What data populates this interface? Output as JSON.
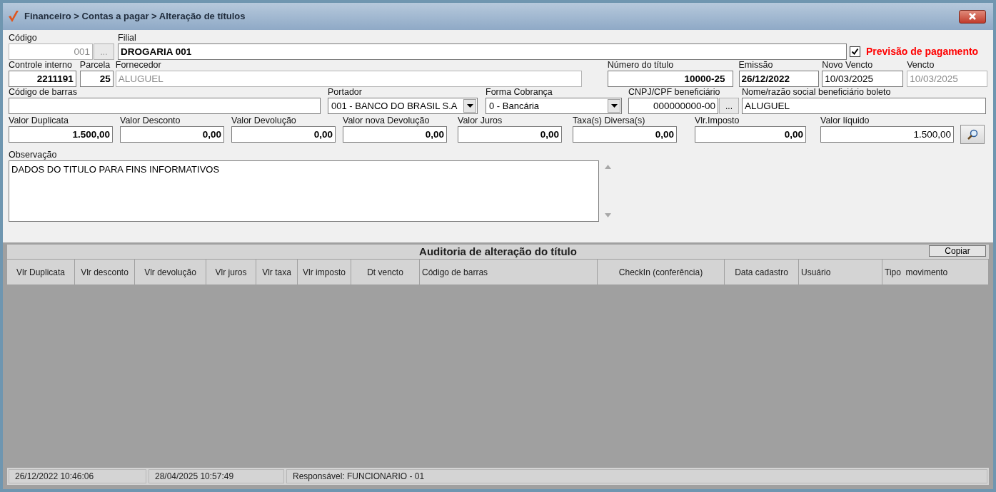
{
  "window": {
    "title": "Financeiro > Contas a pagar > Alteração de títulos"
  },
  "rows": [
    [
      {
        "kind": "text",
        "label": "Código",
        "value": "001",
        "disabled": true
      },
      {
        "kind": "ellipsis",
        "value": "...",
        "disabled": true
      },
      {
        "kind": "text",
        "label": "Filial",
        "value": "DROGARIA 001",
        "disabled": false
      },
      {
        "kind": "check",
        "label": "Previsão de pagamento",
        "checked": true
      }
    ],
    [
      {
        "kind": "text",
        "label": "Controle interno",
        "value": "2211191",
        "disabled": false
      },
      {
        "kind": "text",
        "label": "Parcela",
        "value": "25",
        "disabled": false
      },
      {
        "kind": "text",
        "label": "Fornecedor",
        "value": "ALUGUEL",
        "disabled": true
      },
      {
        "kind": "text",
        "label": "Número do título",
        "value": "10000-25",
        "disabled": false
      },
      {
        "kind": "text",
        "label": "Emissão",
        "value": "26/12/2022",
        "disabled": false
      },
      {
        "kind": "text",
        "label": "Novo Vencto",
        "value": "10/03/2025",
        "disabled": false
      },
      {
        "kind": "text",
        "label": "Vencto",
        "value": "10/03/2025",
        "disabled": true
      }
    ],
    [
      {
        "kind": "text",
        "label": "Código de barras",
        "disabled": false
      },
      {
        "kind": "combo",
        "label": "Portador",
        "value": "001 - BANCO DO BRASIL S.A",
        "disabled": false
      },
      {
        "kind": "combo",
        "label": "Forma Cobrança",
        "value": "0 - Bancária",
        "disabled": false
      },
      {
        "kind": "text",
        "label": "CNPJ/CPF beneficiário",
        "value": "000000000-00",
        "disabled": false
      },
      {
        "kind": "ellipsis",
        "value": "...",
        "disabled": false
      },
      {
        "kind": "text",
        "label": "Nome/razão social beneficiário boleto",
        "value": "ALUGUEL",
        "disabled": false
      }
    ],
    [
      {
        "kind": "text",
        "label": "Valor Duplicata",
        "value": "1.500,00",
        "disabled": false
      },
      {
        "kind": "text",
        "label": "Valor Desconto",
        "value": "0,00",
        "disabled": false
      },
      {
        "kind": "text",
        "label": "Valor Devolução",
        "value": "0,00",
        "disabled": false
      },
      {
        "kind": "text",
        "label": "Valor nova Devolução",
        "value": "0,00",
        "disabled": false
      },
      {
        "kind": "text",
        "label": "Valor Juros",
        "value": "0,00",
        "disabled": false
      },
      {
        "kind": "text",
        "label": "Taxa(s) Diversa(s)",
        "value": "0,00",
        "disabled": false
      },
      {
        "kind": "text",
        "label": "Vlr.Imposto",
        "value": "0,00",
        "disabled": false
      },
      {
        "kind": "text",
        "label": "Valor líquido",
        "value": "1.500,00",
        "disabled": false
      },
      {
        "kind": "search",
        "disabled": false
      }
    ]
  ],
  "observacao": {
    "label": "Observação",
    "value": "DADOS DO TITULO PARA FINS INFORMATIVOS"
  },
  "audit": {
    "title": "Auditoria de alteração do título",
    "copy_button": "Copiar",
    "columns": [
      "Vlr Duplicata",
      "Vlr desconto",
      "Vlr devolução",
      "Vlr juros",
      "Vlr taxa",
      "Vlr imposto",
      "Dt vencto",
      "Código de barras",
      "CheckIn (conferência)",
      "Data cadastro",
      "Usuário",
      "Tipo  movimento"
    ]
  },
  "status_bar": [
    "26/12/2022 10:46:06",
    "28/04/2025 10:57:49",
    "Responsável: FUNCIONARIO - 01"
  ]
}
